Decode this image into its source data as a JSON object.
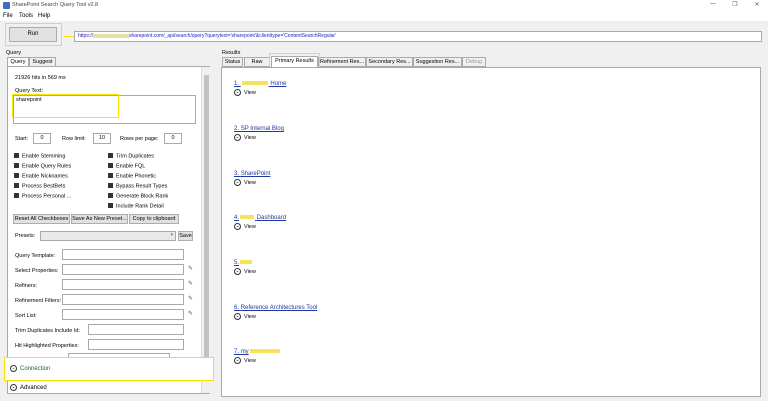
{
  "window": {
    "title": "SharePoint Search Query Tool v2.8",
    "controls": [
      "—",
      "❐",
      "✕"
    ]
  },
  "menu": [
    "File",
    "Tools",
    "Help"
  ],
  "run_label": "Run",
  "url": {
    "prefix": "https://",
    "suffix": "sharepoint.com/_api/search/query?querytext='sharepoint'&clienttype='ContentSearchRegular'"
  },
  "query": {
    "group_label": "Query",
    "tabs": [
      "Query",
      "Suggest"
    ],
    "hits": "21926 hits in 569 ms",
    "query_text_label": "Query Text:",
    "query_text": "sharepoint",
    "start_label": "Start:",
    "start": "0",
    "row_limit_label": "Row limit:",
    "row_limit": "10",
    "rows_per_page_label": "Rows per page:",
    "rows_per_page": "0",
    "checkboxes_left": [
      "Enable Stemming",
      "Enable Query Rules",
      "Enable Nicknames",
      "Process BestBets",
      "Process Personal ..."
    ],
    "checkboxes_right": [
      "Trim Duplicates",
      "Enable FQL",
      "Enable Phonetic",
      "Bypass Result Types",
      "Generate Block Rank",
      "Include Rank Detail"
    ],
    "buttons": [
      "Reset All Checkboxes",
      "Save As New Preset...",
      "Copy to clipboard"
    ],
    "presets_label": "Presets:",
    "save_label": "Save",
    "fields": [
      "Query Template:",
      "Select Properties:",
      "Refiners:",
      "Refinement Filters:",
      "Sort List:",
      "Trim Duplicates Include Id:",
      "Hit Highlighted Properties:"
    ],
    "connection_label": "Connection",
    "advanced_label": "Advanced"
  },
  "results": {
    "group_label": "Results",
    "tabs": [
      "Status",
      "Raw",
      "Primary Results",
      "Refinement Res...",
      "Secondary Res...",
      "Suggestion Res...",
      "Debug"
    ],
    "view_label": "View",
    "items": [
      {
        "prefix": "1.",
        "text": "Home"
      },
      {
        "prefix": "2.",
        "text": "SP Internal Blog"
      },
      {
        "prefix": "3.",
        "text": "SharePoint"
      },
      {
        "prefix": "4.",
        "text": "Dashboard"
      },
      {
        "prefix": "5.",
        "text": ""
      },
      {
        "prefix": "6.",
        "text": "Reference Architectures Tool"
      },
      {
        "prefix": "7.",
        "text": "my"
      }
    ]
  }
}
